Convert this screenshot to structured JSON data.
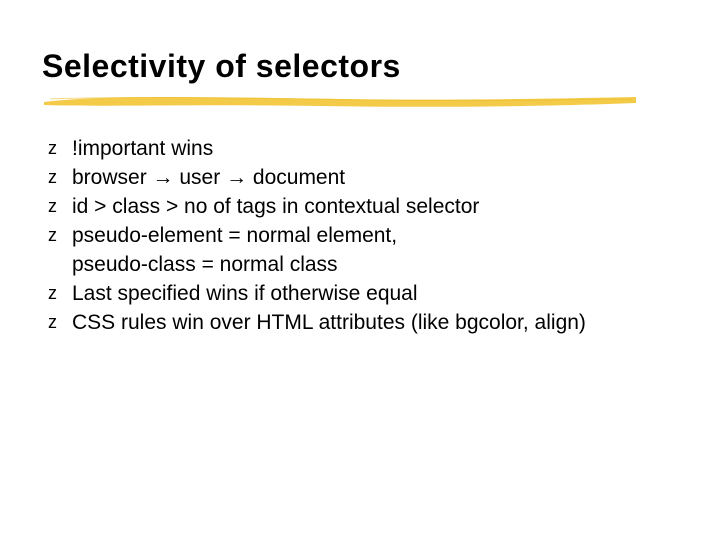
{
  "title": "Selectivity of selectors",
  "bullet_glyph": "z",
  "arrow_glyph": " → ",
  "bullets": [
    {
      "text": "!important wins"
    },
    {
      "parts": [
        "browser",
        "user",
        "document"
      ],
      "joiner": "arrow"
    },
    {
      "text": "id > class > no of tags in contextual selector"
    },
    {
      "text": "pseudo-element = normal element,\npseudo-class = normal class"
    },
    {
      "text": "Last specified wins if otherwise equal"
    },
    {
      "text": "CSS rules win over HTML attributes (like bgcolor, align)"
    }
  ],
  "rule_color": "#f2c73a"
}
